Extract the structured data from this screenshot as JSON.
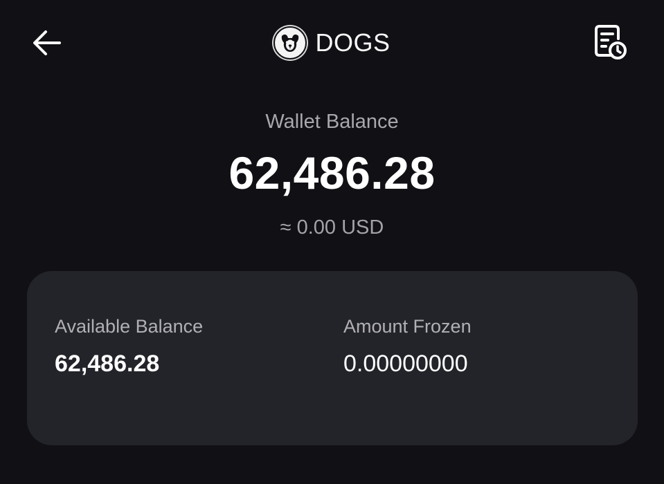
{
  "header": {
    "back_icon": "arrow-left-icon",
    "token_logo_icon": "dogs-token-logo",
    "title": "DOGS",
    "history_icon": "transaction-history-icon"
  },
  "balance": {
    "label": "Wallet Balance",
    "value": "62,486.28",
    "usd": "≈ 0.00 USD"
  },
  "details": {
    "available_label": "Available Balance",
    "available_value": "62,486.28",
    "frozen_label": "Amount Frozen",
    "frozen_value": "0.00000000"
  },
  "colors": {
    "background": "#111015",
    "card": "#232429",
    "text_primary": "#ffffff",
    "text_secondary": "#a8a8ad"
  }
}
